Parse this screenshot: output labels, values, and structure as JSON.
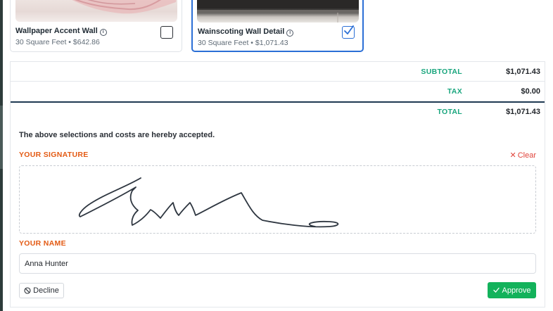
{
  "products": [
    {
      "title": "Wallpaper Accent Wall",
      "detail": "30 Square Feet • $642.86",
      "checked": false
    },
    {
      "title": "Wainscoting Wall Detail",
      "detail": "30 Square Feet • $1,071.43",
      "checked": true
    }
  ],
  "summary": {
    "subtotal_label": "SUBTOTAL",
    "subtotal_value": "$1,071.43",
    "tax_label": "TAX",
    "tax_value": "$0.00",
    "total_label": "TOTAL",
    "total_value": "$1,071.43"
  },
  "acceptance": {
    "statement": "The above selections and costs are hereby accepted.",
    "signature_label": "YOUR SIGNATURE",
    "clear_label": "Clear",
    "name_label": "YOUR NAME",
    "name_value": "Anna Hunter",
    "decline_label": "Decline",
    "approve_label": "Approve"
  },
  "icons": {
    "info": "info-circle-icon",
    "checkbox_checked": "checkmark-icon",
    "clear": "close-icon",
    "decline": "ban-icon",
    "approve": "checkmark-icon"
  },
  "colors": {
    "accent_blue": "#2b6fd6",
    "summary_green": "#1aa67e",
    "label_orange": "#e35a13",
    "clear_red": "#e0433a",
    "approve_green": "#13b25b"
  }
}
